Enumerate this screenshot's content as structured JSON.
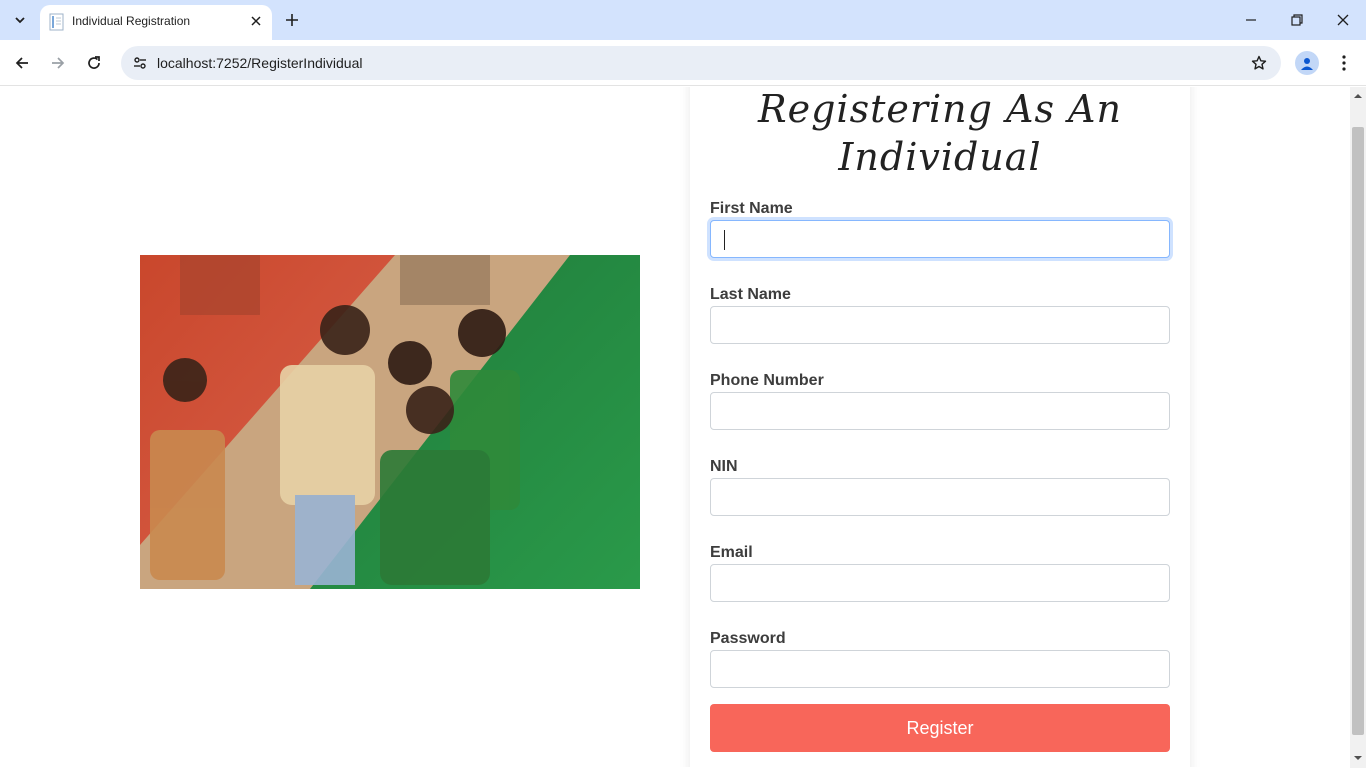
{
  "browser": {
    "tab_title": "Individual Registration",
    "url": "localhost:7252/RegisterIndividual",
    "tab_search_icon": "chevron-down-icon",
    "favicon": "page-icon",
    "new_tab_icon": "plus-icon"
  },
  "page": {
    "heading_line1": "Registering As An",
    "heading_line2": "Individual",
    "hero_image_alt_subject": "children-photo",
    "fields": [
      {
        "label": "First Name",
        "value": "",
        "focused": true
      },
      {
        "label": "Last Name",
        "value": ""
      },
      {
        "label": "Phone Number",
        "value": ""
      },
      {
        "label": "NIN",
        "value": ""
      },
      {
        "label": "Email",
        "value": ""
      },
      {
        "label": "Password",
        "value": ""
      }
    ],
    "register_label": "Register"
  },
  "colors": {
    "accent": "#f8665a",
    "tab_strip": "#d3e3fd",
    "focus_ring": "#86b7fe"
  }
}
